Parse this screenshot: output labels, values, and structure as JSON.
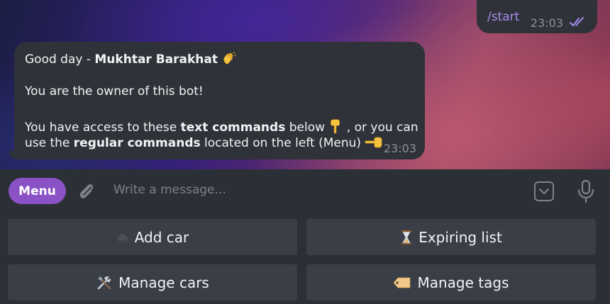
{
  "outgoing": {
    "command": "/start",
    "time": "23:03"
  },
  "incoming": {
    "greeting_prefix": "Good day - ",
    "user_name": "Mukhtar Barakhat",
    "owner_line": "You are the owner of this bot!",
    "access_prefix": "You have access to these ",
    "text_commands": "text commands",
    "access_mid": " below ",
    "access_suffix": ", or you can",
    "use_prefix": "use the ",
    "regular_commands": "regular commands",
    "use_suffix": " located on the left (Menu) ",
    "time": "23:03"
  },
  "input": {
    "menu_label": "Menu",
    "placeholder": "Write a message..."
  },
  "keyboard": {
    "buttons": [
      {
        "label": "Add car",
        "icon": "car-icon"
      },
      {
        "label": "Expiring list",
        "icon": "hourglass-icon"
      },
      {
        "label": "Manage cars",
        "icon": "tools-icon"
      },
      {
        "label": "Manage tags",
        "icon": "tag-icon"
      }
    ]
  },
  "colors": {
    "accent": "#8a52c4",
    "command_text": "#a98cf0",
    "bubble": "#2f3238",
    "button": "#3a3e46"
  }
}
